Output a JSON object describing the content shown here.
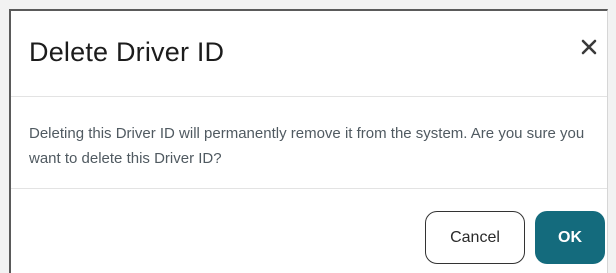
{
  "dialog": {
    "title": "Delete Driver ID",
    "message": "Deleting this Driver ID will permanently remove it from the system. Are you sure you want to delete this Driver ID?",
    "close_icon": "close-icon",
    "buttons": {
      "cancel_label": "Cancel",
      "ok_label": "OK"
    }
  },
  "colors": {
    "primary": "#146b7d",
    "title_text": "#1c1c1c",
    "body_text": "#505a61"
  }
}
